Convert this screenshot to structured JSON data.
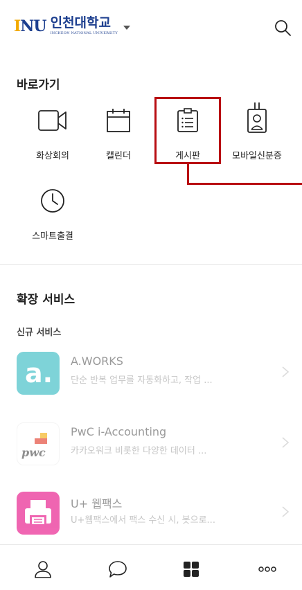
{
  "header": {
    "logo_mark": [
      "I",
      "N",
      "U"
    ],
    "logo_name": "인천대학교",
    "logo_sub": "INCHEON NATIONAL UNIVERSITY",
    "search_icon": "search-icon"
  },
  "shortcuts": {
    "title": "바로가기",
    "items": [
      {
        "label": "화상회의",
        "icon": "video-camera-icon"
      },
      {
        "label": "캘린더",
        "icon": "calendar-icon"
      },
      {
        "label": "게시판",
        "icon": "clipboard-icon",
        "highlighted": true
      },
      {
        "label": "모바일신분증",
        "icon": "id-badge-icon"
      },
      {
        "label": "스마트출결",
        "icon": "clock-icon"
      }
    ]
  },
  "extensions": {
    "title": "확장 서비스",
    "subtitle": "신규 서비스",
    "services": [
      {
        "name": "A.WORKS",
        "desc": "단순 반복 업무를 자동화하고, 작업 ...",
        "icon": "a-works-logo",
        "color": "#2ab7bf"
      },
      {
        "name": "PwC i-Accounting",
        "desc": "카카오워크 비롯한 다양한 데이터 ...",
        "icon": "pwc-logo",
        "color": "#e0301e"
      },
      {
        "name": "U+ 웹팩스",
        "desc": "U+웹팩스에서 팩스 수신 시, 봇으로...",
        "icon": "fax-icon",
        "color": "#e6007e"
      }
    ]
  },
  "bottom_nav": [
    {
      "icon": "profile-icon"
    },
    {
      "icon": "chat-icon"
    },
    {
      "icon": "more-grid-icon",
      "active": true
    },
    {
      "icon": "more-dots-icon"
    }
  ],
  "colors": {
    "highlight": "#b80d12",
    "brand_blue": "#1d3f8f",
    "brand_yellow": "#f2a900"
  }
}
